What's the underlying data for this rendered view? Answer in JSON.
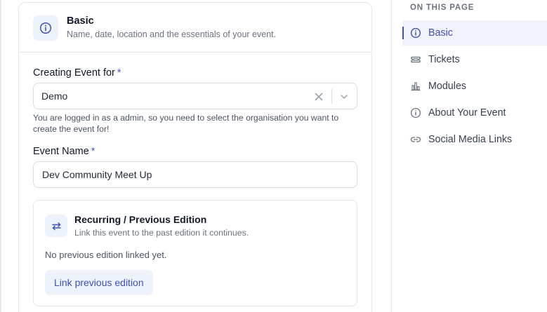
{
  "section": {
    "title": "Basic",
    "subtitle": "Name, date, location and the essentials of your event."
  },
  "fields": {
    "organisation": {
      "label": "Creating Event for",
      "required_marker": "*",
      "value": "Demo",
      "help": "You are logged in as a admin, so you need to select the organisation you want to create the event for!"
    },
    "event_name": {
      "label": "Event Name",
      "required_marker": "*",
      "value": "Dev Community Meet Up"
    }
  },
  "recurring": {
    "title": "Recurring / Previous Edition",
    "subtitle": "Link this event to the past edition it continues.",
    "status": "No previous edition linked yet.",
    "button_label": "Link previous edition"
  },
  "toc": {
    "heading": "ON THIS PAGE",
    "items": [
      {
        "label": "Basic",
        "icon": "info-icon",
        "active": true
      },
      {
        "label": "Tickets",
        "icon": "ticket-icon",
        "active": false
      },
      {
        "label": "Modules",
        "icon": "modules-icon",
        "active": false
      },
      {
        "label": "About Your Event",
        "icon": "info-icon",
        "active": false
      },
      {
        "label": "Social Media Links",
        "icon": "link-icon",
        "active": false
      }
    ]
  },
  "colors": {
    "accent": "#3f51b5",
    "icon_tile": "#eef2fa",
    "border": "#d9dce2"
  }
}
